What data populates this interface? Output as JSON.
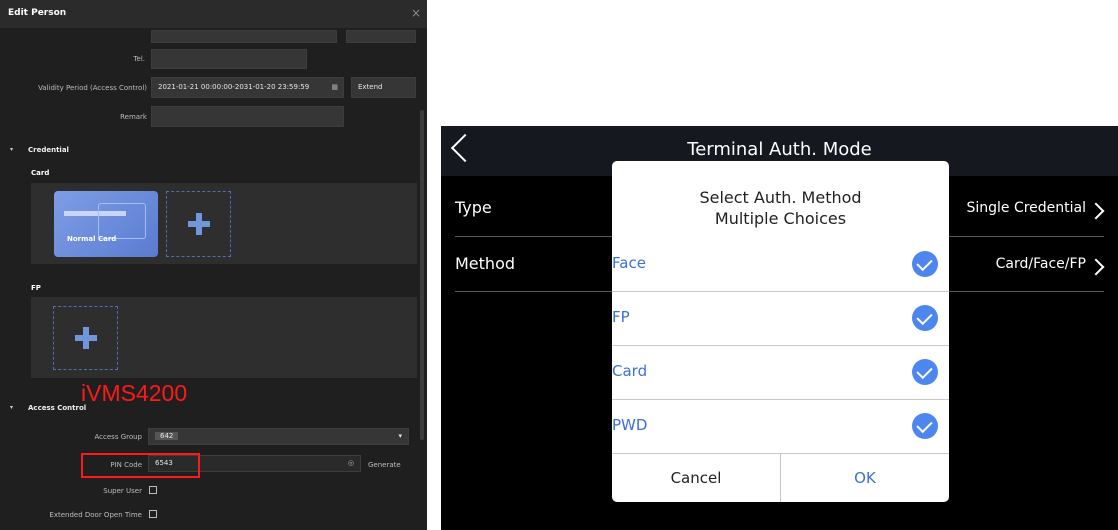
{
  "left": {
    "window_title": "Edit Person",
    "close_glyph": "×",
    "tel_label": "Tel.",
    "validity_label": "Validity Period (Access Control)",
    "validity_value": "2021-01-21 00:00:00-2031-01-20 23:59:59",
    "extend_label": "Extend",
    "remark_label": "Remark",
    "credential_section": "Credential",
    "card_label": "Card",
    "card_type": "Normal Card",
    "fp_label": "FP",
    "access_section": "Access Control",
    "access_group_label": "Access Group",
    "access_group_value": "642",
    "pin_label": "PIN Code",
    "pin_value": "6543",
    "generate_label": "Generate",
    "super_user_label": "Super User",
    "extended_door_label": "Extended Door Open Time",
    "watermark": "iVMS4200",
    "dropdown_glyph": "▾",
    "triangle_glyph": "▾",
    "eye_glyph": "◎",
    "calendar_glyph": "▦"
  },
  "right": {
    "title": "Terminal Auth. Mode",
    "rows": [
      {
        "label": "Type",
        "value": "Single Credential"
      },
      {
        "label": "Method",
        "value": "Card/Face/FP"
      }
    ],
    "dialog": {
      "title_line1": "Select Auth. Method",
      "title_line2": "Multiple Choices",
      "options": [
        {
          "label": "Face",
          "checked": true
        },
        {
          "label": "FP",
          "checked": true
        },
        {
          "label": "Card",
          "checked": true
        },
        {
          "label": "PWD",
          "checked": true
        }
      ],
      "cancel": "Cancel",
      "ok": "OK"
    }
  },
  "colors": {
    "accent_blue": "#4d86ee",
    "option_text": "#3a6fd8",
    "highlight_red": "#ff1a1a",
    "ok_text": "#3a6fd8"
  }
}
